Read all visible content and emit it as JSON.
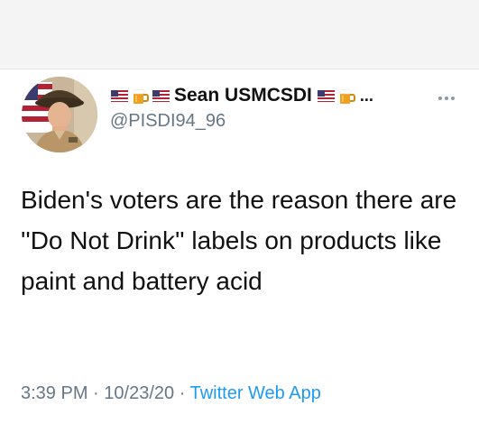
{
  "tweet": {
    "display_name": "Sean USMCSDI",
    "handle": "@PISDI94_96",
    "name_truncation": "...",
    "text": "Biden's voters are the reason there are ''Do Not Drink'' labels on products like paint and battery acid",
    "time": "3:39 PM",
    "separator_1": "·",
    "date": "10/23/20",
    "separator_2": "·",
    "source": "Twitter Web App"
  },
  "icons": {
    "avatar": "profile-photo",
    "flag": "us-flag-icon",
    "beer": "beer-mug-icon",
    "more": "more-options-icon"
  },
  "colors": {
    "text": "#111111",
    "secondary": "#657786",
    "link": "#1d9bf0",
    "more_dots": "#8b98a5",
    "top_band": "#f4f4f5"
  }
}
